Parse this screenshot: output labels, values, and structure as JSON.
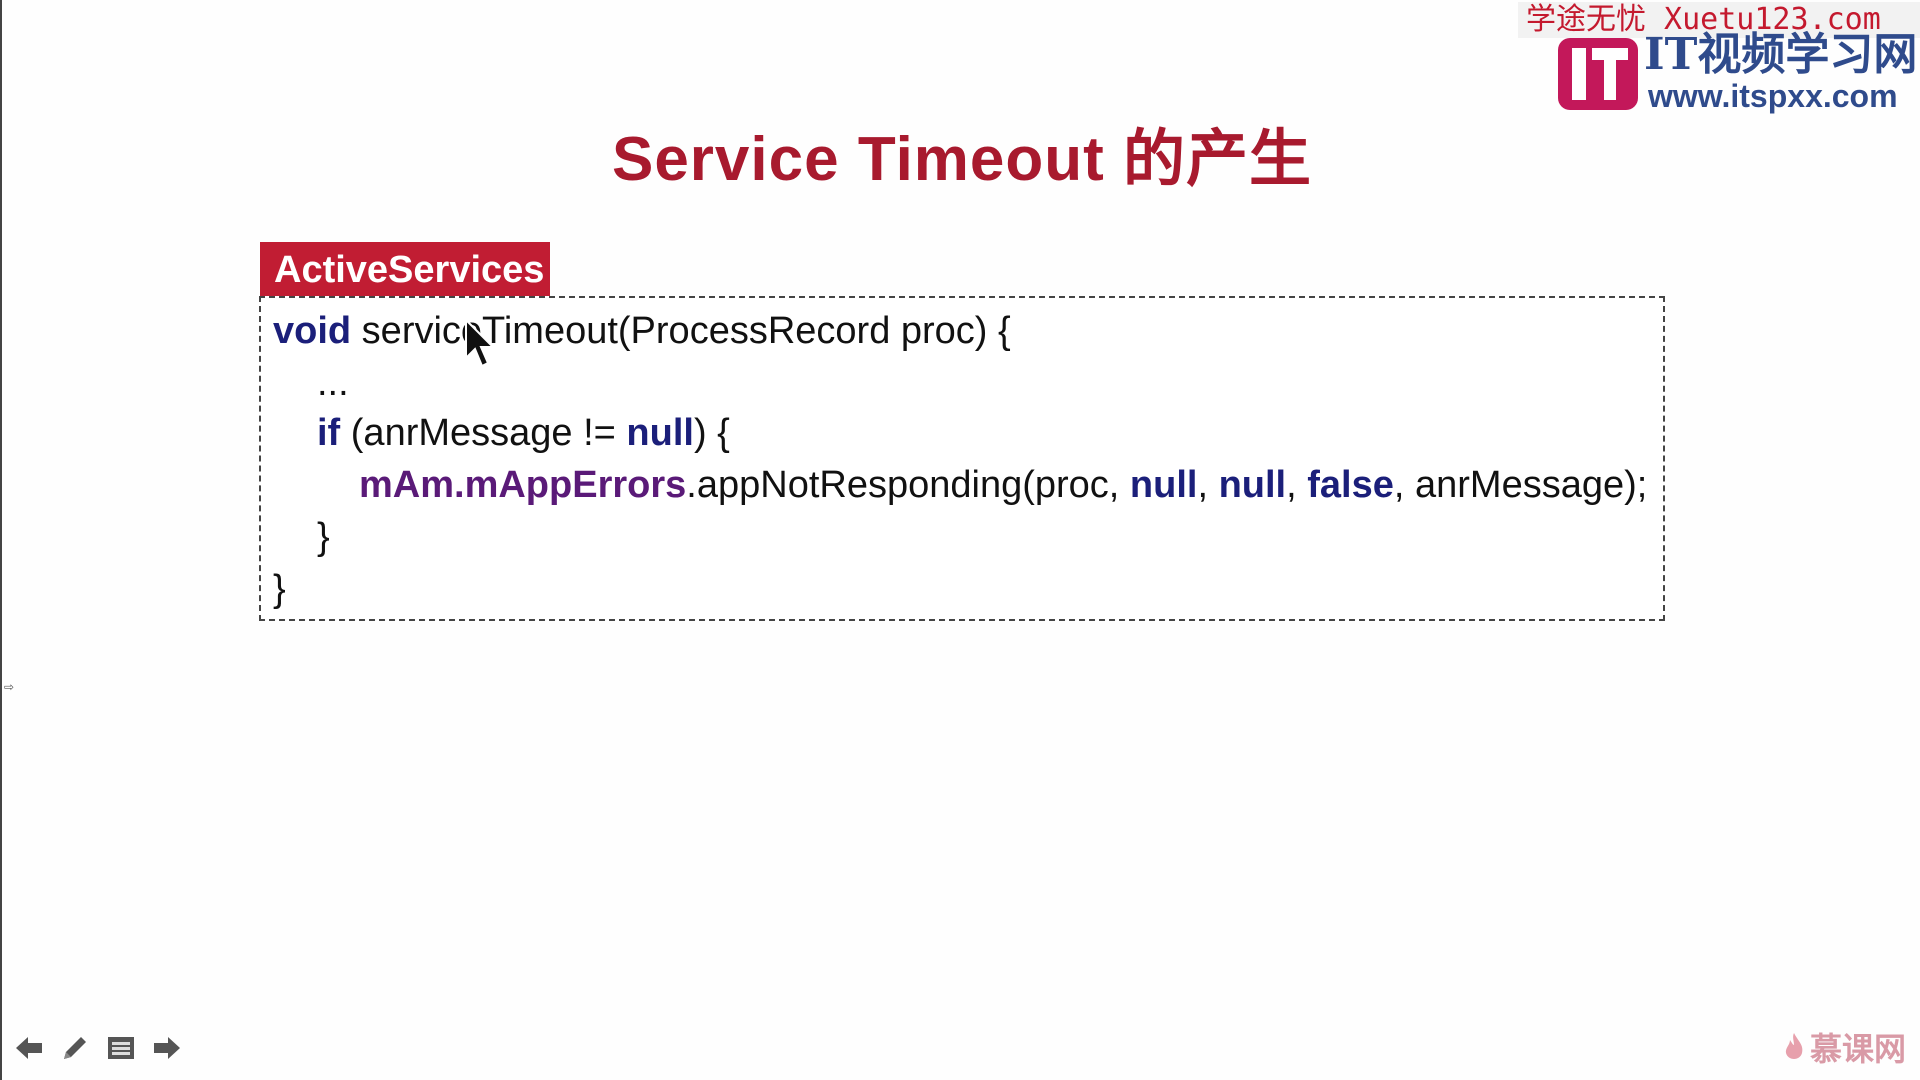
{
  "watermark": {
    "top_text": "学途无忧 Xuetu123.com",
    "brand": "IT视频学习网",
    "url": "www.itspxx.com",
    "logo_color": "#c3185a"
  },
  "slide": {
    "title": "Service Timeout 的产生",
    "class_tag": "ActiveServices",
    "code": {
      "line1_kw": "void",
      "line1_rest": " serviceTimeout(ProcessRecord proc) {",
      "line2": "...",
      "line3_kw": "if",
      "line3_mid": " (anrMessage != ",
      "line3_null": "null",
      "line3_end": ") {",
      "line4_field": "mAm.mAppErrors",
      "line4_call": ".appNotResponding(proc, ",
      "line4_null1": "null",
      "line4_sep1": ", ",
      "line4_null2": "null",
      "line4_sep2": ", ",
      "line4_false": "false",
      "line4_end": ", anrMessage);",
      "line5": "}",
      "line6": "}"
    }
  },
  "nav": {
    "prev_icon": "arrow-left-icon",
    "pen_icon": "pen-icon",
    "menu_icon": "menu-icon",
    "next_icon": "arrow-right-icon"
  },
  "footer": {
    "logo_text": "慕课网"
  },
  "colors": {
    "title": "#a81a2e",
    "tag_bg": "#c11d33",
    "keyword": "#1b1f7a",
    "field": "#5a1a78",
    "watermark_red": "#c4192e",
    "watermark_blue": "#2f4b8c"
  }
}
